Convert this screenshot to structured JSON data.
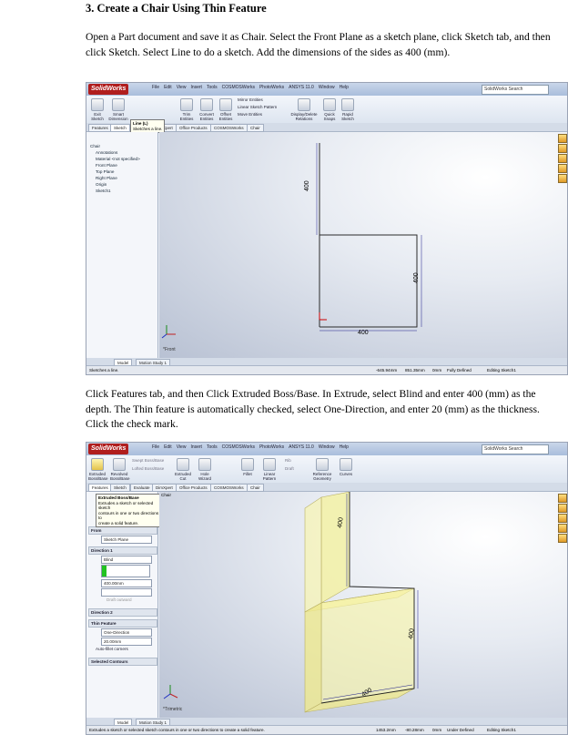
{
  "heading": "3. Create a Chair Using Thin Feature",
  "paragraph1": "Open a Part document and save it as Chair. Select the Front Plane as a sketch plane, click Sketch tab, and then click Sketch. Select Line to do a sketch. Add the dimensions of the sides as 400 (mm).",
  "paragraph2": "Click Features tab, and then Click Extruded Boss/Base. In Extrude, select Blind and enter 400 (mm) as the depth. The Thin feature is automatically checked, select One-Direction, and enter 20 (mm) as the thickness. Click the check mark.",
  "app": {
    "logo": "SolidWorks",
    "menu": [
      "File",
      "Edit",
      "View",
      "Insert",
      "Tools",
      "COSMOSWorks",
      "PhotoWorks",
      "ANSYS 11.0",
      "Window",
      "Help"
    ],
    "search_placeholder": "SolidWorks Search"
  },
  "screenshot1": {
    "ribbon": [
      "Exit Sketch",
      "Smart Dimension",
      "Trim Entities",
      "Convert Entities",
      "Offset Entities",
      "Mirror Entities",
      "Linear Sketch Pattern",
      "Move Entities",
      "Display/Delete Relations",
      "Quick Snaps",
      "Rapid Sketch"
    ],
    "tabs": [
      "Features",
      "Sketch",
      "Evaluate",
      "DimXpert",
      "Office Products",
      "COSMOSWorks",
      "Chair"
    ],
    "tooltip_title": "Line (L)",
    "tooltip_text": "Sketches a line.",
    "tree": [
      "Chair",
      "Annotations",
      "Material <not specified>",
      "Front Plane",
      "Top Plane",
      "Right Plane",
      "Origin",
      "Sketch1"
    ],
    "dims": [
      "400",
      "400",
      "400"
    ],
    "view_label": "*Front",
    "bottom_tabs": [
      "Model",
      "Motion Study 1"
    ],
    "status": {
      "left": "Sketches a line.",
      "x": "-645.94mm",
      "y": "851.35mm",
      "z": "0mm",
      "state": "Fully Defined",
      "mode": "Editing Sketch1"
    }
  },
  "screenshot2": {
    "ribbon": [
      "Extruded Boss/Base",
      "Revolved Boss/Base",
      "Swept Boss/Base",
      "Lofted Boss/Base",
      "Extruded Cut",
      "Hole Wizard",
      "Fillet",
      "Linear Pattern",
      "Rib",
      "Draft",
      "Reference Geometry",
      "Curves"
    ],
    "tabs": [
      "Features",
      "Sketch",
      "Evaluate",
      "DimXpert",
      "Office Products",
      "COSMOSWorks",
      "Chair"
    ],
    "tooltip_title": "Extruded Boss/Base",
    "tooltip_lines": [
      "Extrudes a sketch or selected sketch",
      "contours in one or two directions to",
      "create a solid feature."
    ],
    "panel": {
      "from_hdr": "From",
      "from_value": "Sketch Plane",
      "dir1_hdr": "Direction 1",
      "dir1_value": "Blind",
      "depth": "400.00mm",
      "draft": "Draft outward",
      "dir2_hdr": "Direction 2",
      "thin_hdr": "Thin Feature",
      "thin_type": "One-Direction",
      "thickness": "20.00mm",
      "autofillet": "Auto-fillet corners",
      "contours_hdr": "Selected Contours"
    },
    "tree_root": "Chair",
    "dims": [
      "400",
      "400",
      "400"
    ],
    "view_label": "*Trimetric",
    "bottom_tabs": [
      "Model",
      "Motion Study 1"
    ],
    "status": {
      "left": "Extrudes a sketch or selected sketch contours in one or two directions to create a solid feature.",
      "x": "1453.2mm",
      "y": "-80.28mm",
      "z": "0mm",
      "state": "Under Defined",
      "mode": "Editing Sketch1"
    }
  }
}
